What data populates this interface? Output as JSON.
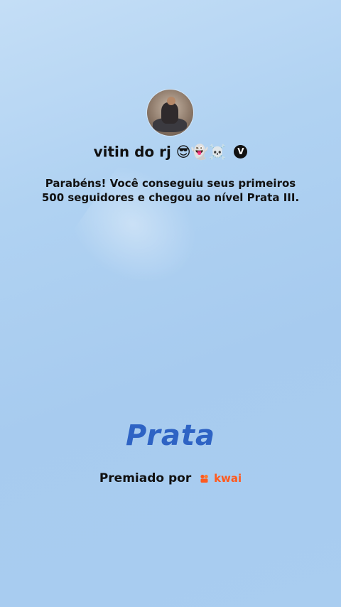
{
  "profile": {
    "name": "vitin do rj",
    "emojis": "😎👻☠️",
    "verified_mark": "V"
  },
  "message": {
    "line1": "Parabéns! Você conseguiu seus primeiros",
    "line2": "500 seguidores e chegou ao nível Prata III."
  },
  "level": {
    "title": "Prata"
  },
  "award": {
    "prefix": "Premiado por",
    "brand": "kwai",
    "brand_color": "#ff5a1f"
  },
  "colors": {
    "level_title": "#2e63c4",
    "text": "#111111"
  }
}
